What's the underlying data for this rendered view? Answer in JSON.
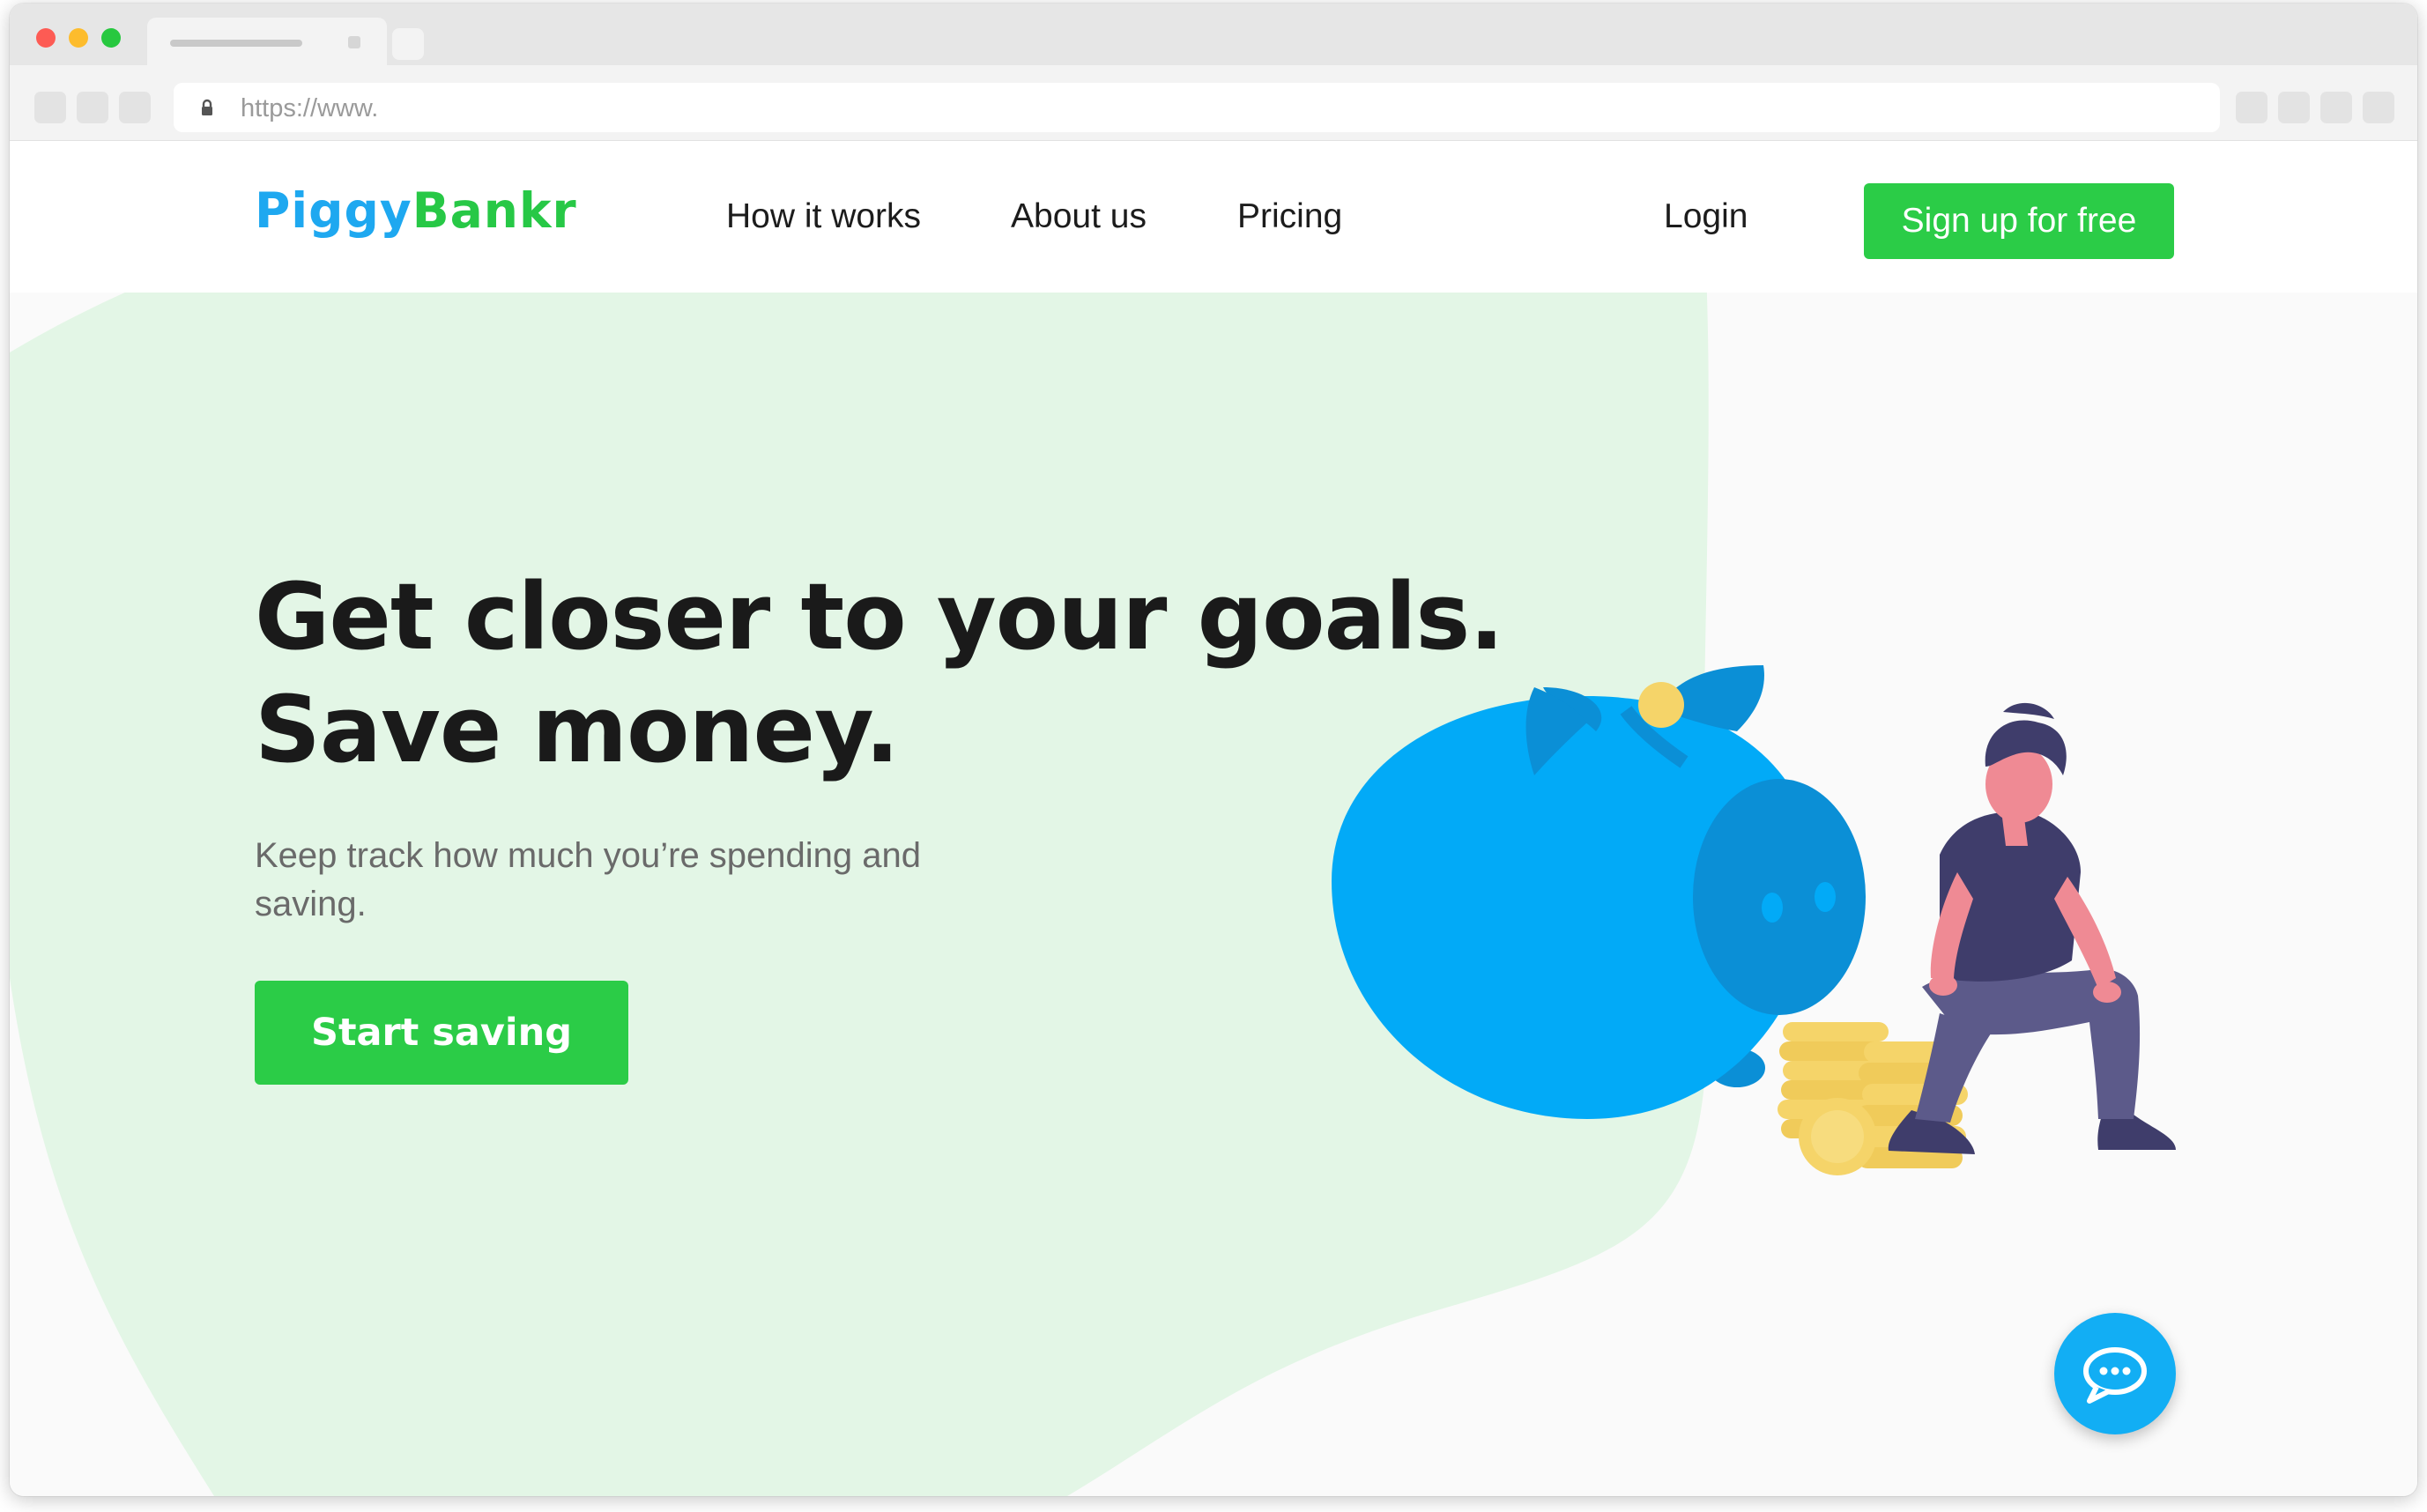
{
  "browser": {
    "url": "https://www."
  },
  "header": {
    "logo": {
      "part1": "Piggy",
      "part2": "Bankr"
    },
    "nav": [
      {
        "label": "How it works"
      },
      {
        "label": "About us"
      },
      {
        "label": "Pricing"
      }
    ],
    "login_label": "Login",
    "signup_label": "Sign up for free"
  },
  "hero": {
    "title_line1": "Get closer to your goals.",
    "title_line2": "Save money.",
    "subtitle": "Keep track how much you’re spending and saving.",
    "cta_label": "Start saving"
  },
  "colors": {
    "brand_blue": "#1ea8f0",
    "brand_green": "#2bcc47",
    "hero_background": "#e3f6e6",
    "piggy_blue": "#02aaf7",
    "coin_gold": "#f5d469"
  },
  "icons": {
    "chat": "chat-bubble-icon",
    "lock": "lock-icon"
  }
}
